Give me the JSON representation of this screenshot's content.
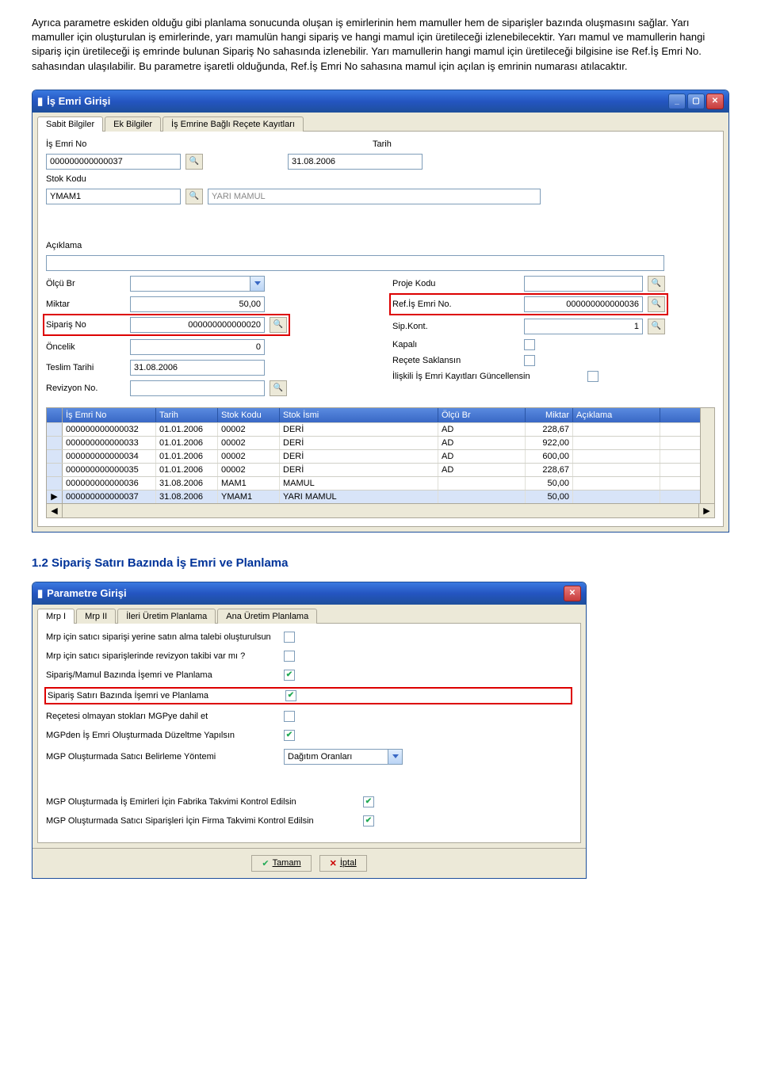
{
  "doc": {
    "paragraph": "Ayrıca parametre eskiden olduğu gibi planlama sonucunda oluşan iş emirlerinin hem mamuller hem de siparişler bazında oluşmasını sağlar. Yarı mamuller için oluşturulan iş emirlerinde, yarı mamulün hangi sipariş ve hangi mamul için üretileceği izlenebilecektir. Yarı mamul ve mamullerin hangi sipariş için üretileceği iş emrinde bulunan Sipariş No sahasında izlenebilir. Yarı mamullerin hangi mamul için üretileceği bilgisine ise Ref.İş Emri No. sahasından ulaşılabilir. Bu parametre işaretli olduğunda, Ref.İş Emri No sahasına mamul için açılan iş emrinin numarası atılacaktır."
  },
  "window1": {
    "title": "İş Emri Girişi",
    "tabs": [
      "Sabit Bilgiler",
      "Ek Bilgiler",
      "İş Emrine Bağlı Reçete Kayıtları"
    ],
    "labels": {
      "isEmriNo": "İş Emri No",
      "tarih": "Tarih",
      "stokKodu": "Stok Kodu",
      "aciklama": "Açıklama",
      "olcuBr": "Ölçü Br",
      "miktar": "Miktar",
      "siparisNo": "Sipariş No",
      "oncelik": "Öncelik",
      "teslimTarihi": "Teslim Tarihi",
      "revizyonNo": "Revizyon No.",
      "projeKodu": "Proje Kodu",
      "refIsEmri": "Ref.İş Emri No.",
      "sipKont": "Sip.Kont.",
      "kapali": "Kapalı",
      "receteSaklansin": "Reçete Saklansın",
      "iliskili": "İlişkili İş Emri Kayıtları Güncellensin"
    },
    "values": {
      "isEmriNo": "000000000000037",
      "tarih": "31.08.2006",
      "stokKodu": "YMAM1",
      "stokDesc": "YARI MAMUL",
      "miktar": "50,00",
      "siparisNo": "000000000000020",
      "oncelik": "0",
      "teslimTarihi": "31.08.2006",
      "refIsEmri": "000000000000036",
      "sipKont": "1"
    },
    "grid": {
      "headers": [
        "İş Emri No",
        "Tarih",
        "Stok Kodu",
        "Stok İsmi",
        "Ölçü Br",
        "Miktar",
        "Açıklama"
      ],
      "rows": [
        [
          "000000000000032",
          "01.01.2006",
          "00002",
          "DERİ",
          "AD",
          "228,67",
          ""
        ],
        [
          "000000000000033",
          "01.01.2006",
          "00002",
          "DERİ",
          "AD",
          "922,00",
          ""
        ],
        [
          "000000000000034",
          "01.01.2006",
          "00002",
          "DERİ",
          "AD",
          "600,00",
          ""
        ],
        [
          "000000000000035",
          "01.01.2006",
          "00002",
          "DERİ",
          "AD",
          "228,67",
          ""
        ],
        [
          "000000000000036",
          "31.08.2006",
          "MAM1",
          "MAMUL",
          "",
          "50,00",
          ""
        ],
        [
          "000000000000037",
          "31.08.2006",
          "YMAM1",
          "YARI MAMUL",
          "",
          "50,00",
          ""
        ]
      ]
    }
  },
  "section2": {
    "title": "1.2 Sipariş Satırı Bazında İş Emri ve Planlama"
  },
  "window2": {
    "title": "Parametre Girişi",
    "tabs": [
      "Mrp I",
      "Mrp II",
      "İleri Üretim Planlama",
      "Ana Üretim Planlama"
    ],
    "params": [
      {
        "label": "Mrp için satıcı siparişi yerine satın alma talebi oluşturulsun",
        "checked": false
      },
      {
        "label": "Mrp için satıcı siparişlerinde revizyon takibi var mı ?",
        "checked": false
      },
      {
        "label": "Sipariş/Mamul Bazında İşemri ve Planlama",
        "checked": true
      },
      {
        "label": "Sipariş Satırı Bazında İşemri ve Planlama",
        "checked": true,
        "highlight": true
      },
      {
        "label": "Reçetesi olmayan stokları MGPye dahil et",
        "checked": false
      },
      {
        "label": "MGPden İş Emri Oluşturmada Düzeltme Yapılsın",
        "checked": true
      }
    ],
    "comboLabel": "MGP Oluşturmada Satıcı Belirleme Yöntemi",
    "comboValue": "Dağıtım Oranları",
    "bottom": [
      {
        "label": "MGP Oluşturmada İş Emirleri İçin Fabrika Takvimi Kontrol Edilsin",
        "checked": true
      },
      {
        "label": "MGP Oluşturmada Satıcı Siparişleri İçin Firma Takvimi Kontrol Edilsin",
        "checked": true
      }
    ],
    "buttons": {
      "ok": "Tamam",
      "cancel": "İptal"
    }
  }
}
